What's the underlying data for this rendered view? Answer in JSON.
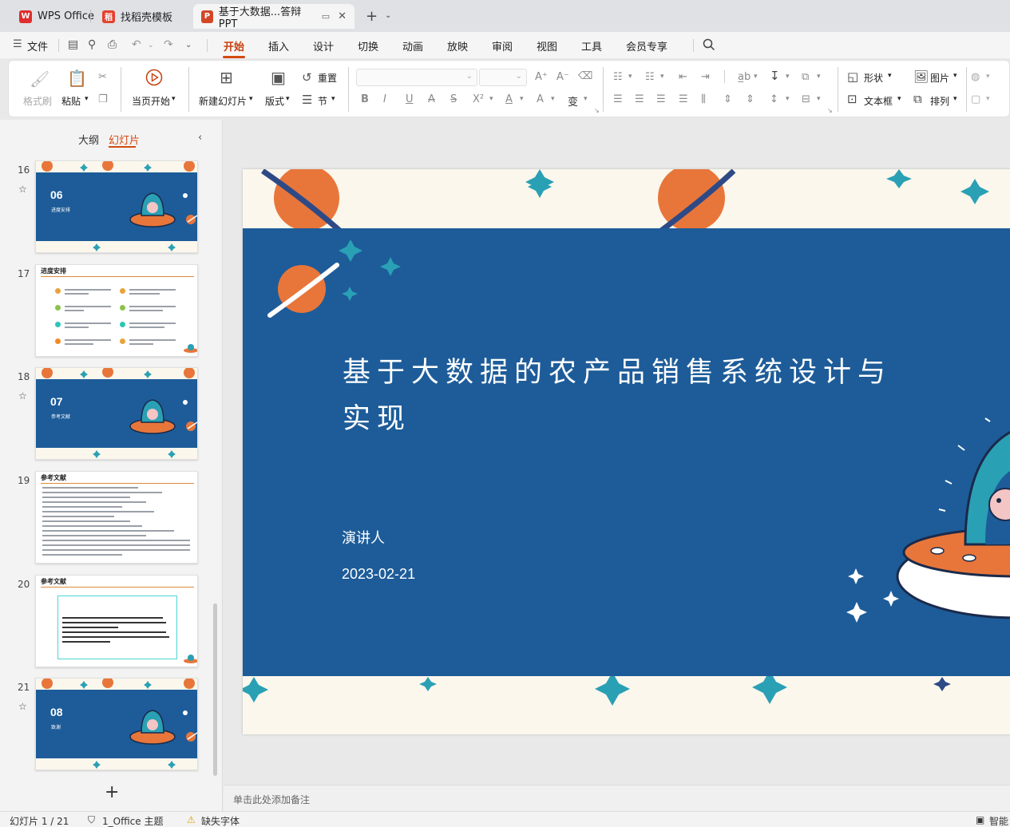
{
  "tabs": [
    {
      "label": "WPS Office",
      "icon": "wps-logo-icon",
      "color": "#e12d2d"
    },
    {
      "label": "找稻壳模板",
      "icon": "docer-logo-icon",
      "color": "#e5412d"
    },
    {
      "label": "基于大数据...答辩PPT",
      "icon": "ppt-logo-icon",
      "color": "#d24726"
    }
  ],
  "menu": {
    "file": "文件",
    "items": [
      "开始",
      "插入",
      "设计",
      "切换",
      "动画",
      "放映",
      "审阅",
      "视图",
      "工具",
      "会员专享"
    ],
    "active": "开始"
  },
  "ribbon": {
    "format_painter": "格式刷",
    "paste": "粘贴",
    "start_from_current": "当页开始",
    "new_slide": "新建幻灯片",
    "layout": "版式",
    "reset": "重置",
    "section": "节",
    "shape": "形状",
    "picture": "图片",
    "textbox": "文本框",
    "arrange": "排列",
    "font_glyphs": {
      "bold": "B",
      "italic": "I",
      "underline": "U",
      "strike": "A",
      "shadow": "S",
      "superscript": "X²",
      "font_color": "A",
      "highlight": "A",
      "phonetic": "变"
    }
  },
  "left_panel": {
    "tab_outline": "大纲",
    "tab_slides": "幻灯片",
    "slides": [
      {
        "num": "16",
        "kind": "section",
        "big": "06",
        "sub": "进度安排",
        "star": true
      },
      {
        "num": "17",
        "kind": "content",
        "title": "进度安排",
        "star": false
      },
      {
        "num": "18",
        "kind": "section",
        "big": "07",
        "sub": "参考文献",
        "star": true
      },
      {
        "num": "19",
        "kind": "content",
        "title": "参考文献",
        "star": false
      },
      {
        "num": "20",
        "kind": "content",
        "title": "参考文献",
        "star": false
      },
      {
        "num": "21",
        "kind": "section",
        "big": "08",
        "sub": "致谢",
        "star": true
      }
    ]
  },
  "slide": {
    "title_line1": "基于大数据的农产品销售系统设计与",
    "title_line2": "实现",
    "presenter": "演讲人",
    "date": "2023-02-21",
    "colors": {
      "band": "#1d5c99",
      "cream": "#fbf7ec",
      "orange": "#e8763a",
      "teal": "#2aa0b5"
    }
  },
  "notes_placeholder": "单击此处添加备注",
  "status": {
    "slide_counter": "幻灯片 1 / 21",
    "theme": "1_Office 主题",
    "missing_fonts": "缺失字体",
    "smart": "智能"
  }
}
